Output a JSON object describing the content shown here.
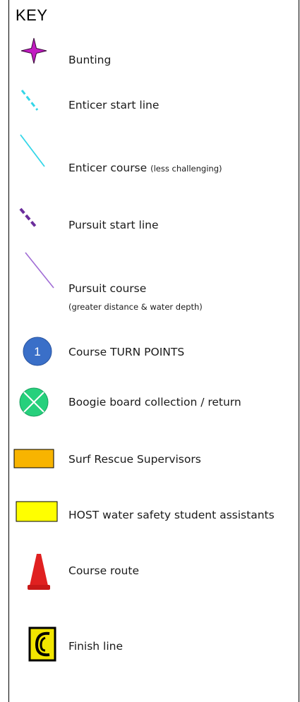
{
  "key": {
    "title": "KEY",
    "items": [
      {
        "icon": "bunting-star-icon",
        "label": "Bunting"
      },
      {
        "icon": "enticer-start-line-icon",
        "label": "Enticer start line"
      },
      {
        "icon": "enticer-course-line-icon",
        "label": "Enticer course",
        "note": "(less challenging)"
      },
      {
        "icon": "pursuit-start-line-icon",
        "label": "Pursuit start line"
      },
      {
        "icon": "pursuit-course-line-icon",
        "label": "Pursuit course",
        "note": "(greater distance & water depth)"
      },
      {
        "icon": "turn-point-circle-icon",
        "label": "Course TURN POINTS",
        "badge": "1"
      },
      {
        "icon": "boogie-board-icon",
        "label": "Boogie board collection / return"
      },
      {
        "icon": "orange-rectangle-icon",
        "label": "Surf Rescue Supervisors"
      },
      {
        "icon": "yellow-rectangle-icon",
        "label": "HOST water safety student assistants"
      },
      {
        "icon": "traffic-cone-icon",
        "label": "Course route"
      },
      {
        "icon": "finish-line-sign-icon",
        "label": "Finish line"
      }
    ]
  },
  "colors": {
    "bunting": "#c21cc2",
    "enticer": "#33d6e8",
    "pursuit_start": "#6b2d9c",
    "pursuit_course": "#a06cd5",
    "turn_point": "#3a6fc8",
    "boogie": "#26d07c",
    "supervisors": "#f8b400",
    "assistants": "#ffff00",
    "cone": "#e02020",
    "finish": "#f2e600"
  }
}
